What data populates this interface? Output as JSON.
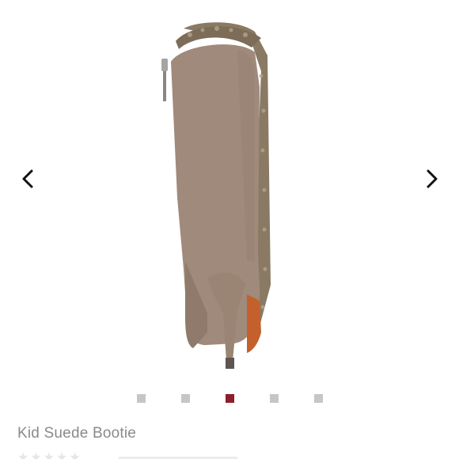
{
  "product": {
    "title": "Kid Suede Bootie",
    "image_icon": "suede-bootie-image",
    "rating_stars": "★★★★★"
  },
  "carousel": {
    "prev_icon": "chevron-left-icon",
    "next_icon": "chevron-right-icon",
    "dot_count": 5,
    "active_index": 2
  },
  "colors": {
    "active_dot": "#8e1e2a",
    "inactive_dot": "#c6c6c6",
    "title_text": "#8a8a8a",
    "suede": "#a08a7b",
    "outsole": "#c4602c"
  }
}
